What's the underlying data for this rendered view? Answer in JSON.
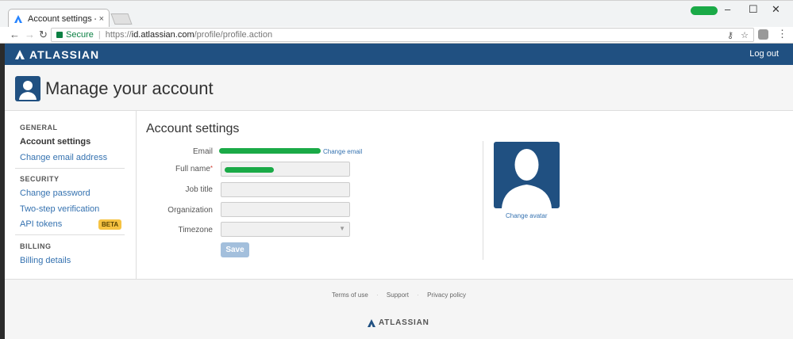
{
  "browser": {
    "tab_title": "Account settings - Atlas",
    "tab_close": "×",
    "secure_label": "Secure",
    "url_scheme": "https://",
    "url_host": "id.atlassian.com",
    "url_path": "/profile/profile.action",
    "window_controls": [
      "–",
      "☐",
      "✕"
    ]
  },
  "header": {
    "brand": "ATLASSIAN",
    "logout": "Log out"
  },
  "page": {
    "title": "Manage your account"
  },
  "sidebar": {
    "general_heading": "GENERAL",
    "account_settings": "Account settings",
    "change_email": "Change email address",
    "security_heading": "SECURITY",
    "change_password": "Change password",
    "two_step": "Two-step verification",
    "api_tokens": "API tokens",
    "beta_badge": "BETA",
    "billing_heading": "BILLING",
    "billing_details": "Billing details"
  },
  "form": {
    "title": "Account settings",
    "email_label": "Email",
    "change_email_link": "Change email",
    "fullname_label": "Full name",
    "required_mark": "*",
    "jobtitle_label": "Job title",
    "organization_label": "Organization",
    "timezone_label": "Timezone",
    "save_button": "Save",
    "change_avatar": "Change avatar"
  },
  "footer": {
    "terms": "Terms of use",
    "support": "Support",
    "privacy": "Privacy policy",
    "logo": "ATLASSIAN"
  },
  "colors": {
    "brand_blue": "#205081",
    "link_blue": "#3572b0",
    "beta_yellow": "#f6c342",
    "redaction_green": "#1aaa47"
  },
  "icons": [
    "atlassian-logo-icon",
    "lock-icon",
    "key-icon",
    "star-icon",
    "user-avatar-icon",
    "chevron-down-icon"
  ]
}
